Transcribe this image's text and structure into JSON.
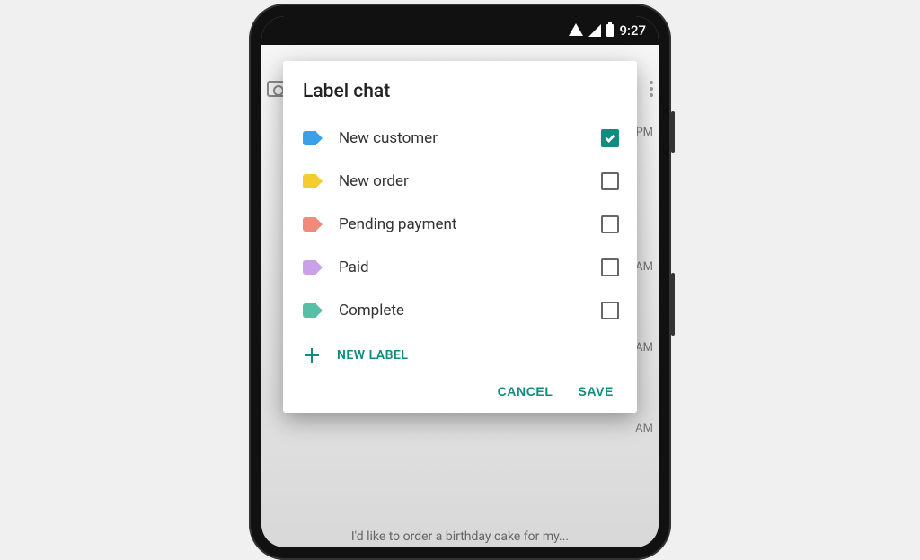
{
  "status_bar": {
    "time": "9:27"
  },
  "dialog": {
    "title": "Label chat",
    "labels": [
      {
        "name": "New customer",
        "color": "#3aa1e8",
        "checked": true
      },
      {
        "name": "New order",
        "color": "#f4cc2f",
        "checked": false
      },
      {
        "name": "Pending payment",
        "color": "#f08a7a",
        "checked": false
      },
      {
        "name": "Paid",
        "color": "#c9a1e8",
        "checked": false
      },
      {
        "name": "Complete",
        "color": "#55c0a4",
        "checked": false
      }
    ],
    "new_label": "NEW LABEL",
    "actions": {
      "cancel": "CANCEL",
      "save": "SAVE"
    }
  },
  "background": {
    "partial_message": "I'd like to order a birthday cake for my...",
    "time_suffixes": [
      "PM",
      "AM",
      "AM",
      "AM"
    ]
  }
}
